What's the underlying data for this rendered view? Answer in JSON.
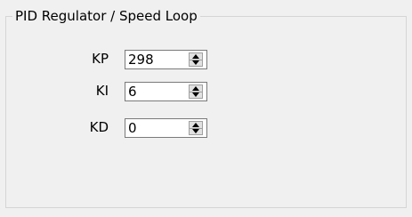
{
  "group": {
    "title": "PID Regulator / Speed Loop"
  },
  "fields": [
    {
      "label": "KP",
      "value": "298"
    },
    {
      "label": "KI",
      "value": "6"
    },
    {
      "label": "KD",
      "value": "0"
    }
  ],
  "icons": {
    "up": "triangle-up-icon",
    "down": "triangle-down-icon"
  }
}
